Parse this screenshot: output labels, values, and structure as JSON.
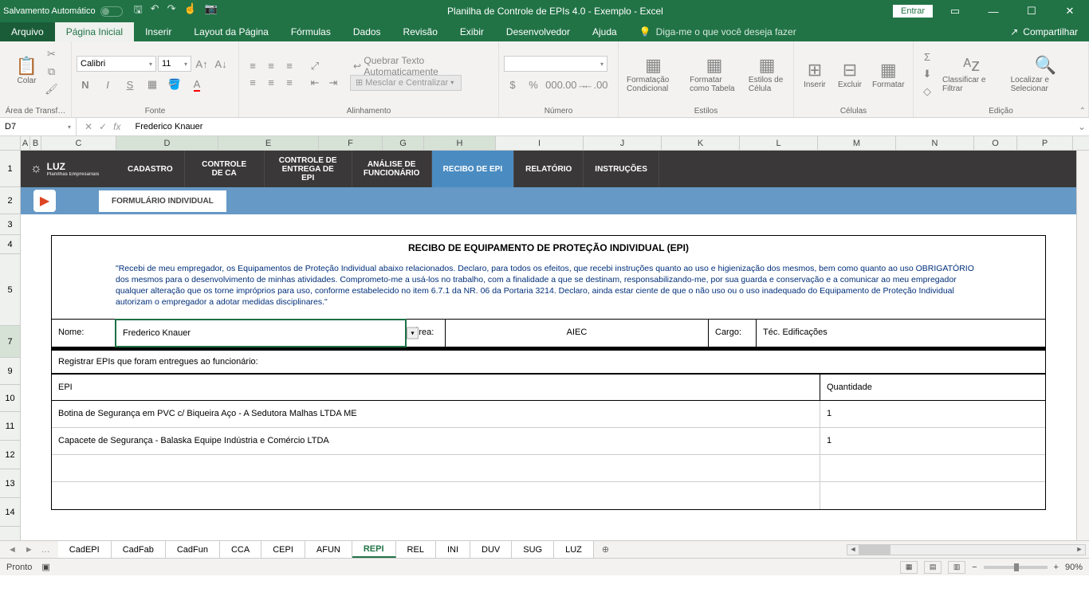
{
  "titlebar": {
    "autosave": "Salvamento Automático",
    "title": "Planilha de Controle de EPIs 4.0 - Exemplo  -  Excel",
    "signin": "Entrar"
  },
  "menu": {
    "file": "Arquivo",
    "tabs": [
      "Página Inicial",
      "Inserir",
      "Layout da Página",
      "Fórmulas",
      "Dados",
      "Revisão",
      "Exibir",
      "Desenvolvedor",
      "Ajuda"
    ],
    "tellme": "Diga-me o que você deseja fazer",
    "share": "Compartilhar"
  },
  "ribbon": {
    "clipboard": {
      "paste": "Colar",
      "label": "Área de Transf…"
    },
    "font": {
      "name": "Calibri",
      "size": "11",
      "label": "Fonte"
    },
    "alignment": {
      "wrap": "Quebrar Texto Automaticamente",
      "merge": "Mesclar e Centralizar",
      "label": "Alinhamento"
    },
    "number": {
      "label": "Número"
    },
    "styles": {
      "cond": "Formatação Condicional",
      "table": "Formatar como Tabela",
      "cell": "Estilos de Célula",
      "label": "Estilos"
    },
    "cells": {
      "insert": "Inserir",
      "delete": "Excluir",
      "format": "Formatar",
      "label": "Células"
    },
    "editing": {
      "sort": "Classificar e Filtrar",
      "find": "Localizar e Selecionar",
      "label": "Edição"
    }
  },
  "formula": {
    "cell": "D7",
    "value": "Frederico Knauer"
  },
  "cols": [
    "A",
    "B",
    "C",
    "D",
    "E",
    "F",
    "G",
    "H",
    "I",
    "J",
    "K",
    "L",
    "M",
    "N",
    "O",
    "P"
  ],
  "rows": [
    "1",
    "2",
    "3",
    "4",
    "5",
    "7",
    "9",
    "10",
    "11",
    "12",
    "13",
    "14"
  ],
  "nav": {
    "items": [
      "CADASTRO",
      "CONTROLE DE CA",
      "CONTROLE DE ENTREGA DE EPI",
      "ANÁLISE DE FUNCIONÁRIO",
      "RECIBO DE EPI",
      "RELATÓRIO",
      "INSTRUÇÕES"
    ],
    "logo1": "LUZ",
    "logo2": "Planilhas Empresariais",
    "subtab": "FORMULÁRIO INDIVIDUAL"
  },
  "form": {
    "title": "RECIBO DE EQUIPAMENTO DE PROTEÇÃO INDIVIDUAL (EPI)",
    "text": "\"Recebi de meu empregador, os Equipamentos de  Proteção Individual   abaixo relacionados. Declaro, para todos os efeitos, que recebi instruções quanto ao uso e higienização dos mesmos, bem como quanto ao uso OBRIGATÓRIO dos mesmos para o desenvolvimento de minhas atividades. Comprometo-me a  usá-los no trabalho, com a finalidade a que se destinam, responsabilizando-me, por sua guarda e conservação e a comunicar ao meu empregador qualquer alteração que os torne impróprios para uso, conforme estabelecido no item 6.7.1 da NR. 06 da Portaria 3214. Declaro, ainda estar ciente de que o não uso ou o uso inadequado do Equipamento de Proteção Individual autorizam o empregador a adotar medidas disciplinares.\"",
    "nome_label": "Nome:",
    "nome": "Frederico Knauer",
    "area_label": "Área:",
    "area": "AIEC",
    "cargo_label": "Cargo:",
    "cargo": "Téc. Edificações",
    "reg": "Registrar EPIs que foram entregues ao funcionário:",
    "col_epi": "EPI",
    "col_qtd": "Quantidade",
    "items": [
      {
        "epi": "Botina de Segurança em PVC c/ Biqueira Aço - A Sedutora Malhas LTDA ME",
        "qtd": "1"
      },
      {
        "epi": "Capacete de Segurança - Balaska Equipe Indústria e Comércio LTDA",
        "qtd": "1"
      }
    ]
  },
  "sheets": [
    "CadEPI",
    "CadFab",
    "CadFun",
    "CCA",
    "CEPI",
    "AFUN",
    "REPI",
    "REL",
    "INI",
    "DUV",
    "SUG",
    "LUZ"
  ],
  "status": {
    "ready": "Pronto",
    "zoom": "90%"
  }
}
